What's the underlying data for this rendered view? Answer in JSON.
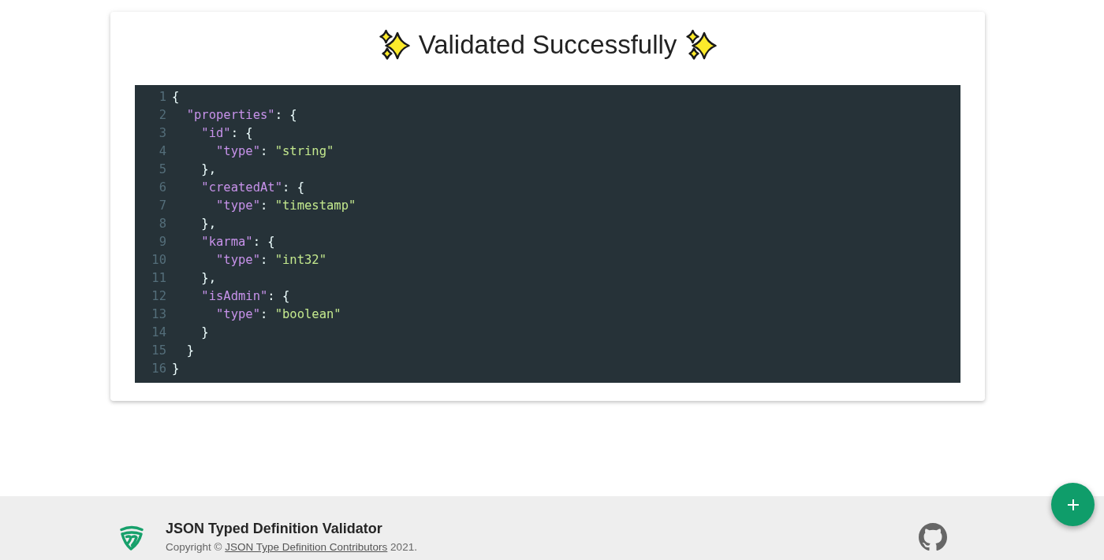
{
  "result": {
    "title": "Validated Successfully",
    "code_lines": [
      {
        "number": "1",
        "tokens": [
          {
            "kind": "punct",
            "text": "{"
          }
        ],
        "children": [
          {
            "number": "2",
            "tokens": [
              {
                "kind": "key",
                "text": "\"properties\""
              },
              {
                "kind": "punct",
                "text": ": {"
              }
            ],
            "children": [
              {
                "number": "3",
                "tokens": [
                  {
                    "kind": "key",
                    "text": "\"id\""
                  },
                  {
                    "kind": "punct",
                    "text": ": {"
                  }
                ],
                "children": [
                  {
                    "number": "4",
                    "tokens": [
                      {
                        "kind": "key",
                        "text": "\"type\""
                      },
                      {
                        "kind": "punct",
                        "text": ": "
                      },
                      {
                        "kind": "string",
                        "text": "\"string\""
                      }
                    ]
                  }
                ]
              },
              {
                "number": "5",
                "tokens": [
                  {
                    "kind": "punct",
                    "text": "},"
                  }
                ]
              },
              {
                "number": "6",
                "tokens": [
                  {
                    "kind": "key",
                    "text": "\"createdAt\""
                  },
                  {
                    "kind": "punct",
                    "text": ": {"
                  }
                ],
                "children": [
                  {
                    "number": "7",
                    "tokens": [
                      {
                        "kind": "key",
                        "text": "\"type\""
                      },
                      {
                        "kind": "punct",
                        "text": ": "
                      },
                      {
                        "kind": "string",
                        "text": "\"timestamp\""
                      }
                    ]
                  }
                ]
              },
              {
                "number": "8",
                "tokens": [
                  {
                    "kind": "punct",
                    "text": "},"
                  }
                ]
              },
              {
                "number": "9",
                "tokens": [
                  {
                    "kind": "key",
                    "text": "\"karma\""
                  },
                  {
                    "kind": "punct",
                    "text": ": {"
                  }
                ],
                "children": [
                  {
                    "number": "10",
                    "tokens": [
                      {
                        "kind": "key",
                        "text": "\"type\""
                      },
                      {
                        "kind": "punct",
                        "text": ": "
                      },
                      {
                        "kind": "string",
                        "text": "\"int32\""
                      }
                    ]
                  }
                ]
              },
              {
                "number": "11",
                "tokens": [
                  {
                    "kind": "punct",
                    "text": "},"
                  }
                ]
              },
              {
                "number": "12",
                "tokens": [
                  {
                    "kind": "key",
                    "text": "\"isAdmin\""
                  },
                  {
                    "kind": "punct",
                    "text": ": {"
                  }
                ],
                "children": [
                  {
                    "number": "13",
                    "tokens": [
                      {
                        "kind": "key",
                        "text": "\"type\""
                      },
                      {
                        "kind": "punct",
                        "text": ": "
                      },
                      {
                        "kind": "string",
                        "text": "\"boolean\""
                      }
                    ]
                  }
                ]
              },
              {
                "number": "14",
                "tokens": [
                  {
                    "kind": "punct",
                    "text": "}"
                  }
                ]
              }
            ]
          },
          {
            "number": "15",
            "tokens": [
              {
                "kind": "punct",
                "text": "}"
              }
            ]
          }
        ]
      },
      {
        "number": "16",
        "tokens": [
          {
            "kind": "punct",
            "text": "}"
          }
        ]
      }
    ]
  },
  "footer": {
    "title": "JSON Typed Definition Validator",
    "copyright_prefix": "Copyright ©",
    "copyright_link": "JSON Type Definition Contributors",
    "copyright_suffix": "2021."
  }
}
